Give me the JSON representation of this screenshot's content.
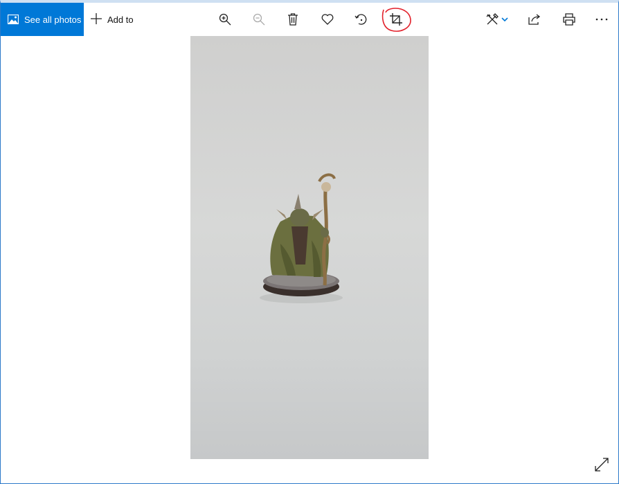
{
  "toolbar": {
    "see_all_label": "See all photos",
    "add_to_label": "Add to",
    "icons": [
      "zoom-in-icon",
      "zoom-out-icon",
      "delete-icon",
      "favorite-icon",
      "rotate-icon",
      "crop-icon",
      "edit-icon",
      "chevron-down-icon",
      "share-icon",
      "print-icon",
      "more-icon"
    ]
  },
  "colors": {
    "accent": "#0078d7",
    "annotation": "#e2202a",
    "photo_background": "#d4d5d4",
    "figure_robe": "#6b6f3f",
    "figure_base": "#3a302c"
  },
  "photo": {
    "subject": "painted miniature figure with staff on round base"
  }
}
